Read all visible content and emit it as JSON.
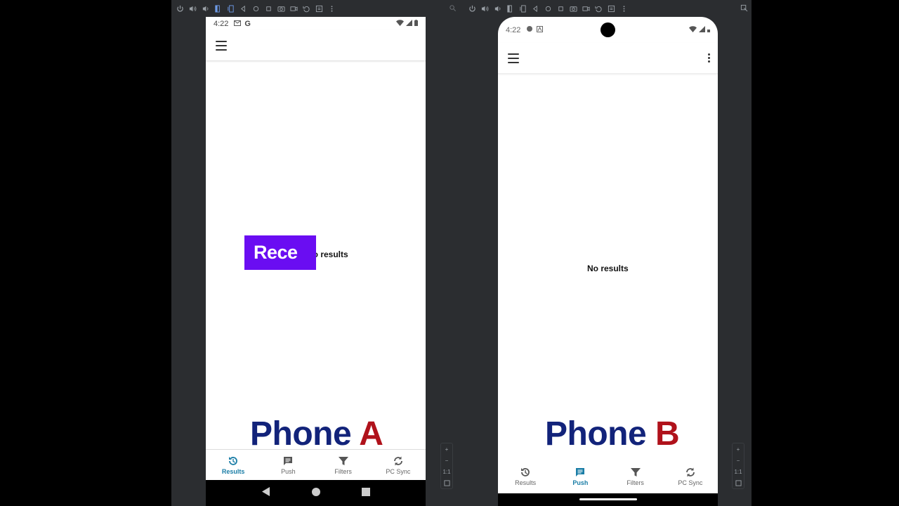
{
  "phone_a": {
    "status": {
      "time": "4:22",
      "g_label": "G"
    },
    "no_results": "No results",
    "overlay_text": "Rece",
    "label": {
      "prefix": "Phone ",
      "letter": "A"
    },
    "nav": [
      {
        "label": "Results",
        "icon": "history-icon",
        "active": true
      },
      {
        "label": "Push",
        "icon": "message-icon",
        "active": false
      },
      {
        "label": "Filters",
        "icon": "filter-icon",
        "active": false
      },
      {
        "label": "PC Sync",
        "icon": "sync-icon",
        "active": false
      }
    ]
  },
  "phone_b": {
    "status": {
      "time": "4:22"
    },
    "no_results": "No results",
    "label": {
      "prefix": "Phone ",
      "letter": "B"
    },
    "nav": [
      {
        "label": "Results",
        "icon": "history-icon",
        "active": false
      },
      {
        "label": "Push",
        "icon": "message-icon",
        "active": true
      },
      {
        "label": "Filters",
        "icon": "filter-icon",
        "active": false
      },
      {
        "label": "PC Sync",
        "icon": "sync-icon",
        "active": false
      }
    ]
  },
  "zoom": {
    "plus": "+",
    "minus": "−",
    "ratio": "1:1"
  },
  "colors": {
    "accent": "#1a7da6",
    "overlay": "#6a0df2",
    "label_blue": "#12237a",
    "label_red": "#b0121b"
  }
}
